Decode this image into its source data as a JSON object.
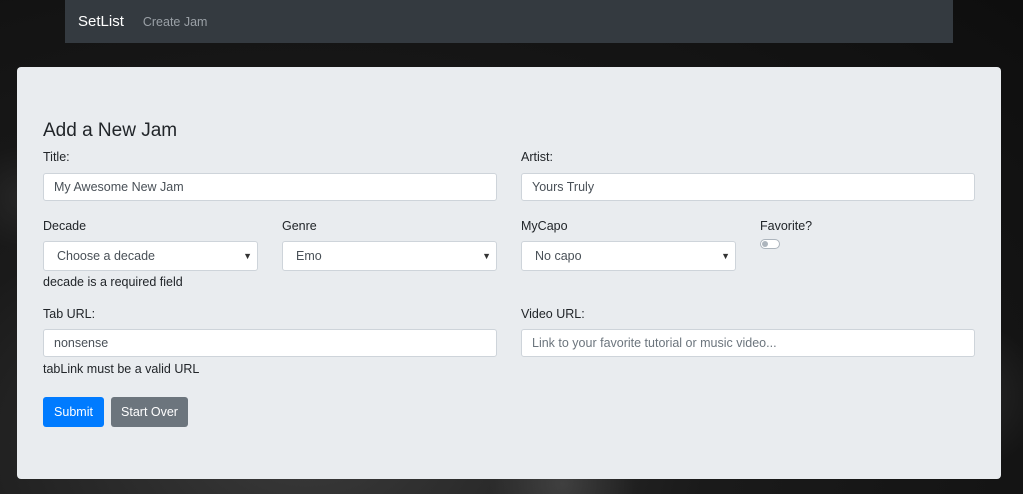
{
  "navbar": {
    "brand": "SetList",
    "links": [
      "Create Jam"
    ]
  },
  "form": {
    "heading": "Add a New Jam",
    "title": {
      "label": "Title:",
      "value": "My Awesome New Jam"
    },
    "artist": {
      "label": "Artist:",
      "value": "Yours Truly"
    },
    "decade": {
      "label": "Decade",
      "selected": "Choose a decade",
      "error": "decade is a required field"
    },
    "genre": {
      "label": "Genre",
      "selected": "Emo"
    },
    "mycapo": {
      "label": "MyCapo",
      "selected": "No capo"
    },
    "favorite": {
      "label": "Favorite?",
      "checked": false
    },
    "tab_url": {
      "label": "Tab URL:",
      "value": "nonsense",
      "error": "tabLink must be a valid URL"
    },
    "video_url": {
      "label": "Video URL:",
      "value": "",
      "placeholder": "Link to your favorite tutorial or music video..."
    },
    "buttons": {
      "submit": "Submit",
      "start_over": "Start Over"
    }
  },
  "colors": {
    "navbar_bg": "#343a40",
    "card_bg": "#e9ecef",
    "primary": "#007bff",
    "secondary": "#6c757d"
  }
}
